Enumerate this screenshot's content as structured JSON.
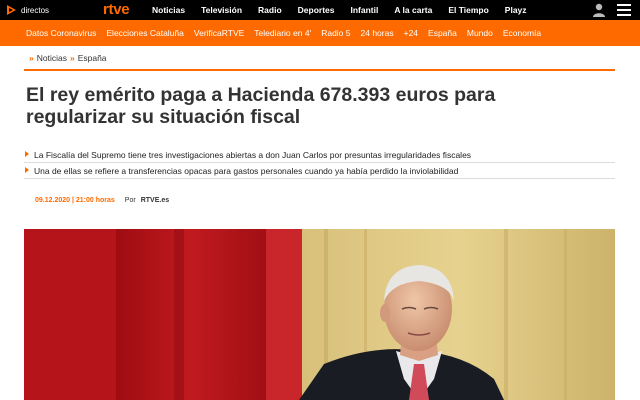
{
  "topbar": {
    "directos_label": "directos",
    "logo_text": "rtve",
    "nav": [
      "Noticias",
      "Televisión",
      "Radio",
      "Deportes",
      "Infantil",
      "A la carta",
      "El Tiempo",
      "Playz"
    ]
  },
  "subnav": [
    "Datos Coronavirus",
    "Elecciones Cataluña",
    "VerificaRTVE",
    "Telediario en 4'",
    "Radio 5",
    "24 horas",
    "+24",
    "España",
    "Mundo",
    "Economía"
  ],
  "breadcrumb": {
    "sep": "»",
    "items": [
      "Noticias",
      "España"
    ]
  },
  "article": {
    "headline_line1": "El rey emérito paga a Hacienda 678.393 euros para",
    "headline_line2": "regularizar su situación fiscal",
    "bullets": [
      "La Fiscalía del Supremo tiene tres investigaciones abiertas a don Juan Carlos por presuntas irregularidades fiscales",
      "Una de ellas se refiere a transferencias opacas para gastos personales cuando ya había perdido la inviolabilidad"
    ],
    "date": "09.12.2020 | 21:00 horas",
    "por": "Por",
    "author": "RTVE.es"
  },
  "colors": {
    "brand_orange": "#ff6a00",
    "top_bar": "#000000",
    "text": "#333333"
  },
  "icons": {
    "play": "play-icon",
    "user": "user-icon",
    "menu": "menu-icon"
  }
}
